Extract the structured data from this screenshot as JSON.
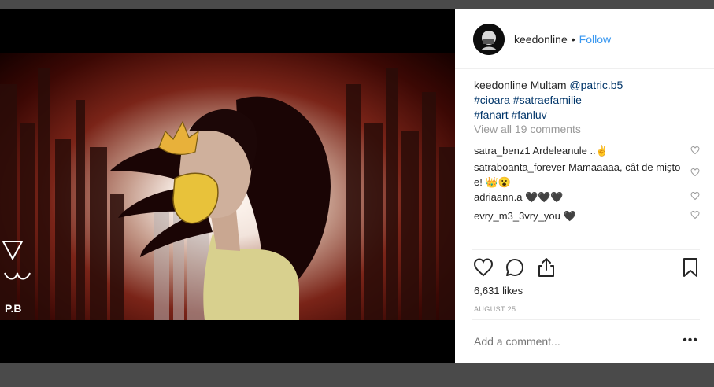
{
  "post": {
    "username": "keedonline",
    "separator": "•",
    "follow_label": "Follow",
    "caption": {
      "username": "keedonline",
      "text": "Multam",
      "mention": "@patric.b5",
      "hashtags_line1": "#cioara #satraefamilie",
      "hashtags_line2": "#fanart #fanluv"
    },
    "view_all_label": "View all 19 comments",
    "comments": [
      {
        "text": "satra_benz1 Ardeleanule ..✌"
      },
      {
        "text": "satraboanta_forever Mamaaaaa, cât de mişto e! 👑😮"
      },
      {
        "text": "adriaann.a 🖤🖤🖤"
      },
      {
        "text": "evry_m3_3vry_you 🖤"
      }
    ],
    "likes": "6,631 likes",
    "date": "AUGUST 25",
    "add_comment_placeholder": "Add a comment...",
    "more_label": "•••",
    "artwork_signature": "P.B"
  },
  "colors": {
    "link": "#003569",
    "follow": "#3897f0",
    "muted": "#999999"
  }
}
